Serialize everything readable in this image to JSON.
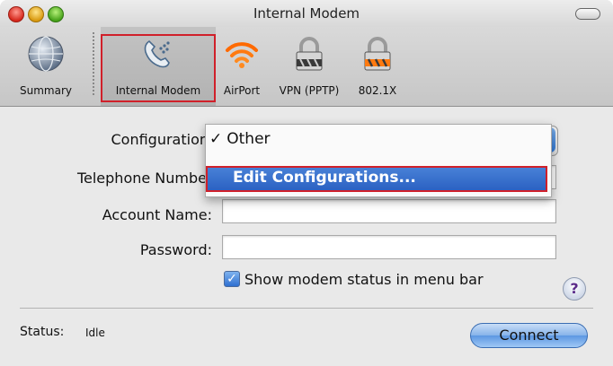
{
  "window": {
    "title": "Internal Modem"
  },
  "toolbar": {
    "items": [
      {
        "label": "Summary",
        "icon": "globe-icon"
      },
      {
        "label": "Internal Modem",
        "icon": "phone-modem-icon"
      },
      {
        "label": "AirPort",
        "icon": "wifi-icon"
      },
      {
        "label": "VPN (PPTP)",
        "icon": "lock-icon"
      },
      {
        "label": "802.1X",
        "icon": "lock-icon"
      }
    ]
  },
  "form": {
    "configuration_label": "Configuration",
    "telephone_label": "Telephone Numbe",
    "account_label": "Account Name:",
    "password_label": "Password:",
    "account_value": "",
    "password_value": "",
    "show_status_label": "Show modem status in menu bar",
    "show_status_checked": true
  },
  "menu": {
    "other_label": "Other",
    "check_mark": "✓",
    "edit_label": "Edit Configurations..."
  },
  "help": {
    "label": "?"
  },
  "status": {
    "label": "Status:",
    "value": "Idle"
  },
  "actions": {
    "connect_label": "Connect"
  },
  "colors": {
    "highlight_border": "#d0202a",
    "menu_selection": "#2a60c2",
    "button_blue": "#5c97e2"
  }
}
